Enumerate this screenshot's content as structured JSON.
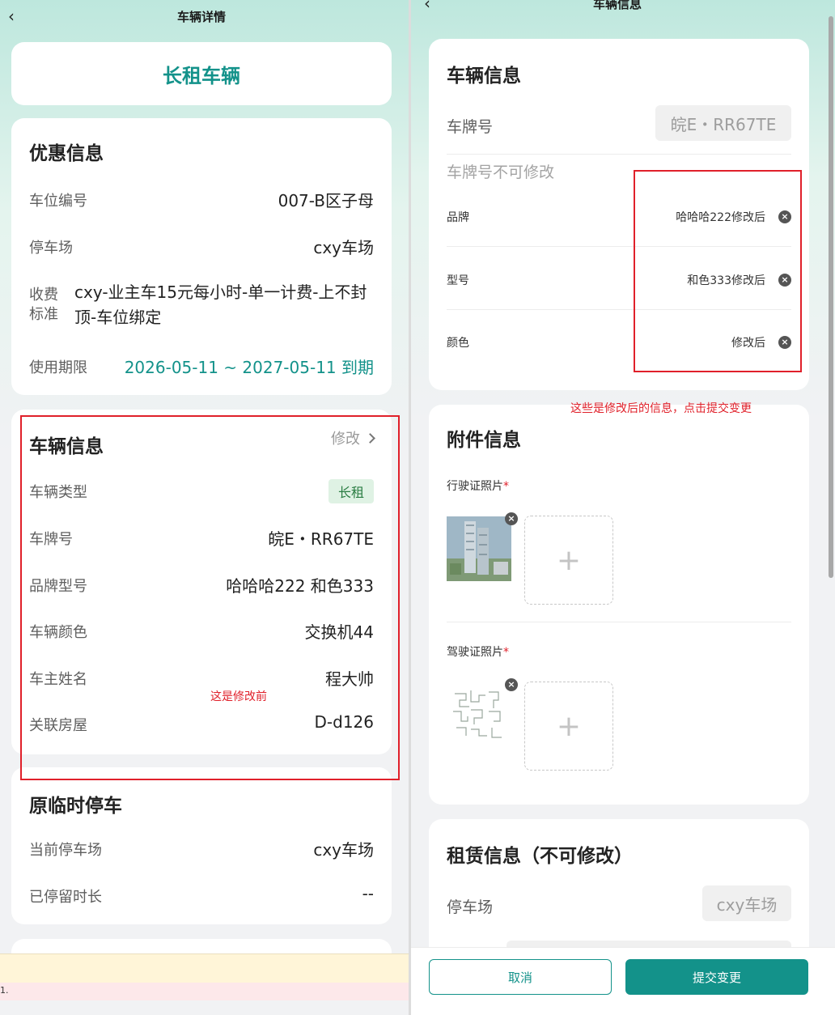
{
  "left": {
    "nav_title": "车辆详情",
    "back_glyph": "‹",
    "hero_title": "长租车辆",
    "discount": {
      "title": "优惠信息",
      "rows": [
        {
          "label": "车位编号",
          "value": "007-B区子母"
        },
        {
          "label": "停车场",
          "value": "cxy车场"
        }
      ],
      "fee_label": "收费标准",
      "fee_value": "cxy-业主车15元每小时-单一计费-上不封顶-车位绑定",
      "period_label": "使用期限",
      "period_value": "2026-05-11 ~ 2027-05-11 到期"
    },
    "vehicle": {
      "title": "车辆信息",
      "edit_label": "修改",
      "type_label": "车辆类型",
      "type_tag": "长租",
      "rows": [
        {
          "label": "车牌号",
          "value": "皖E・RR67TE"
        },
        {
          "label": "品牌型号",
          "value": "哈哈哈222 和色333"
        },
        {
          "label": "车辆颜色",
          "value": "交换机44"
        },
        {
          "label": "车主姓名",
          "value": "程大帅"
        },
        {
          "label": "关联房屋",
          "value": "D-d126"
        }
      ]
    },
    "temp_parking": {
      "title": "原临时停车",
      "rows": [
        {
          "label": "当前停车场",
          "value": "cxy车场"
        },
        {
          "label": "已停留时长",
          "value": "--"
        }
      ]
    },
    "pink_bar_text": "1."
  },
  "annotations": {
    "before_note": "这是修改前",
    "after_note": "这些是修改后的信息，点击提交变更",
    "color": "#e0202a"
  },
  "right": {
    "nav_title": "车辆信息",
    "back_glyph": "‹",
    "info": {
      "title": "车辆信息",
      "plate_label": "车牌号",
      "plate_value": "皖E・RR67TE",
      "plate_hint": "车牌号不可修改",
      "fields": [
        {
          "label": "品牌",
          "value": "哈哈哈222修改后"
        },
        {
          "label": "型号",
          "value": "和色333修改后"
        },
        {
          "label": "颜色",
          "value": "修改后"
        }
      ],
      "clear_glyph": "×"
    },
    "attachments": {
      "title": "附件信息",
      "license_label": "行驶证照片",
      "driver_label": "驾驶证照片",
      "required_mark": "*",
      "upload_glyph": "+"
    },
    "lease": {
      "title": "租赁信息（不可修改）",
      "lot_label": "停车场",
      "lot_value": "cxy车场"
    },
    "buttons": {
      "cancel": "取消",
      "submit": "提交变更"
    }
  },
  "colors": {
    "brand_teal": "#13928a",
    "tag_bg": "#dff2e4",
    "tag_text": "#2a7d43"
  }
}
